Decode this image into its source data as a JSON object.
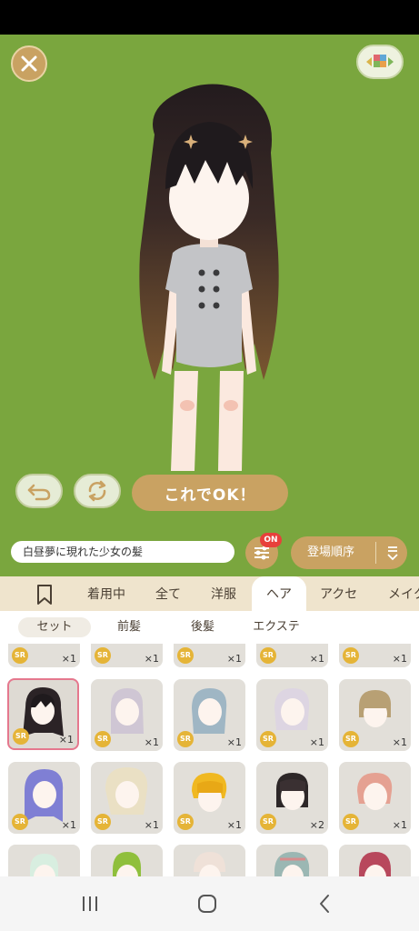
{
  "ok_button": {
    "label": "これでOK！"
  },
  "item_name": "白昼夢に現れた少女の髪",
  "filter": {
    "badge": "ON"
  },
  "sort": {
    "label": "登場順序"
  },
  "category_tabs": [
    "着用中",
    "全て",
    "洋服",
    "ヘア",
    "アクセ",
    "メイク"
  ],
  "active_category": "ヘア",
  "sub_tabs": [
    "セット",
    "前髪",
    "後髪",
    "エクステ"
  ],
  "active_sub_tab": "セット",
  "grid_items": {
    "row0": [
      {
        "rarity": "SR",
        "count": "×1"
      },
      {
        "rarity": "SR",
        "count": "×1"
      },
      {
        "rarity": "SR",
        "count": "×1"
      },
      {
        "rarity": "SR",
        "count": "×1"
      },
      {
        "rarity": "SR",
        "count": "×1"
      }
    ],
    "row1": [
      {
        "rarity": "SR",
        "count": "×1",
        "selected": true
      },
      {
        "rarity": "SR",
        "count": "×1"
      },
      {
        "rarity": "SR",
        "count": "×1"
      },
      {
        "rarity": "SR",
        "count": "×1"
      },
      {
        "rarity": "SR",
        "count": "×1"
      }
    ],
    "row2": [
      {
        "rarity": "SR",
        "count": "×1"
      },
      {
        "rarity": "SR",
        "count": "×1"
      },
      {
        "rarity": "SR",
        "count": "×1"
      },
      {
        "rarity": "SR",
        "count": "×2"
      },
      {
        "rarity": "SR",
        "count": "×1"
      }
    ]
  },
  "colors": {
    "background_green": "#7aa63e",
    "accent_gold": "#c9a262",
    "badge_red": "#e8403b",
    "rarity_gold": "#e5b437",
    "selected_border": "#e5788e"
  },
  "icons": {
    "close": "close-icon",
    "palette": "palette-grid-icon",
    "undo": "undo-icon",
    "reset": "refresh-icon",
    "filter": "sliders-icon",
    "sort_toggle": "sort-arrow-icon",
    "bookmark": "bookmark-icon",
    "nav_recents": "recents-icon",
    "nav_home": "home-icon",
    "nav_back": "back-icon"
  }
}
